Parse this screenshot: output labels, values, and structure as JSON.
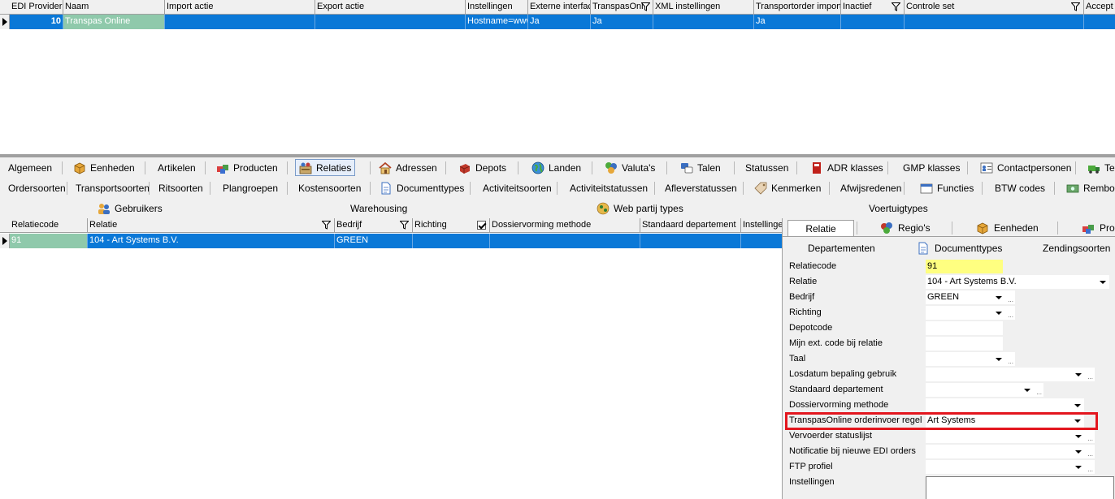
{
  "top_grid": {
    "columns": [
      "EDI Provider",
      "Naam",
      "Import actie",
      "Export actie",
      "Instellingen",
      "Externe interfac",
      "TranspasOnl",
      "XML instellingen",
      "Transportorder import",
      "Inactief",
      "Controle set",
      "Accept"
    ],
    "row": {
      "id": "10",
      "naam": "Transpas Online",
      "import_actie": "",
      "export_actie": "",
      "instellingen": "Hostname=www",
      "externe_interface": "Ja",
      "transpasonline": "Ja",
      "xml_instellingen": "",
      "transportorder_import": "Ja",
      "inactief": "",
      "controle_set": "",
      "accept": ""
    }
  },
  "tabs_row1": [
    "Algemeen",
    "Eenheden",
    "Artikelen",
    "Producten",
    "Relaties",
    "Adressen",
    "Depots",
    "Landen",
    "Valuta's",
    "Talen",
    "Statussen",
    "ADR klasses",
    "GMP klasses",
    "Contactpersonen",
    "Te"
  ],
  "tabs_row2": [
    "Ordersoorten",
    "Transportsoorten",
    "Ritsoorten",
    "Plangroepen",
    "Kostensoorten",
    "Documenttypes",
    "Activiteitsoorten",
    "Activiteitstatussen",
    "Afleverstatussen",
    "Kenmerken",
    "Afwijsredenen",
    "Functies",
    "BTW codes",
    "Rembou"
  ],
  "tabs_row3": [
    "Gebruikers",
    "Warehousing",
    "Web partij types",
    "Voertuigtypes"
  ],
  "bottom_grid": {
    "columns": [
      "Relatiecode",
      "Relatie",
      "Bedrijf",
      "Richting",
      "Dossiervorming methode",
      "Standaard departement",
      "Instellinge"
    ],
    "row": {
      "relatiecode": "91",
      "relatie": "104 - Art Systems B.V.",
      "bedrijf": "GREEN",
      "richting": "",
      "dossiervorming": "",
      "departement": "",
      "instellingen": ""
    }
  },
  "right_panel": {
    "tabs": [
      "Relatie",
      "Regio's",
      "Eenheden",
      "Pro"
    ],
    "subtabs": [
      "Departementen",
      "Documenttypes",
      "Zendingsoorten"
    ],
    "fields": [
      {
        "label": "Relatiecode",
        "value": "91"
      },
      {
        "label": "Relatie",
        "value": "104 - Art Systems B.V."
      },
      {
        "label": "Bedrijf",
        "value": "GREEN"
      },
      {
        "label": "Richting",
        "value": ""
      },
      {
        "label": "Depotcode",
        "value": ""
      },
      {
        "label": "Mijn ext. code bij relatie",
        "value": ""
      },
      {
        "label": "Taal",
        "value": ""
      },
      {
        "label": "Losdatum bepaling gebruik",
        "value": ""
      },
      {
        "label": "Standaard departement",
        "value": ""
      },
      {
        "label": "Dossiervorming methode",
        "value": ""
      },
      {
        "label": "TranspasOnline orderinvoer regel",
        "value": "Art Systems"
      },
      {
        "label": "Vervoerder statuslijst",
        "value": ""
      },
      {
        "label": "Notificatie bij nieuwe EDI orders",
        "value": ""
      },
      {
        "label": "FTP profiel",
        "value": ""
      },
      {
        "label": "Instellingen",
        "value": ""
      }
    ],
    "ellipsis": "..."
  },
  "colors": {
    "selection": "#0a78d7",
    "name_cell": "#8fc9ab",
    "code_highlight": "#ffff80",
    "highlight_border": "#e3161e"
  }
}
